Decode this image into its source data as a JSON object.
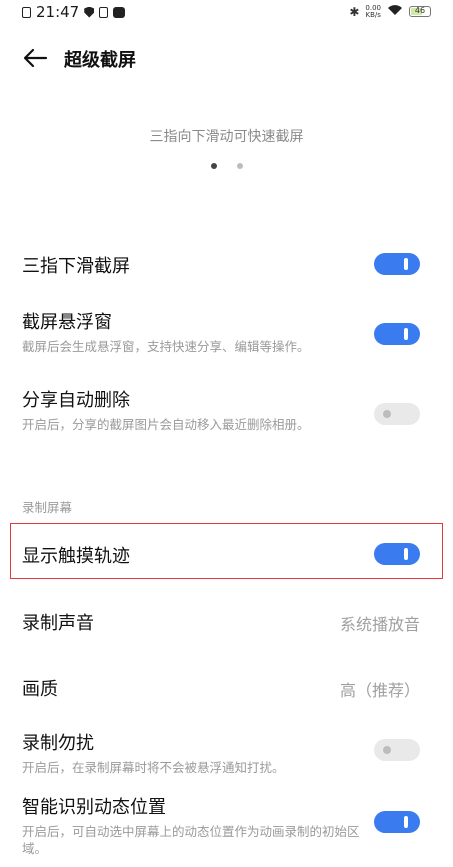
{
  "status_bar": {
    "time": "21:47",
    "net_speed_value": "0.00",
    "net_speed_unit": "KB/s",
    "battery": "46"
  },
  "header": {
    "title": "超级截屏"
  },
  "banner": {
    "hint": "三指向下滑动可快速截屏"
  },
  "settings": [
    {
      "label": "三指下滑截屏",
      "desc": "",
      "toggle": true
    },
    {
      "label": "截屏悬浮窗",
      "desc": "截屏后会生成悬浮窗，支持快速分享、编辑等操作。",
      "toggle": true
    },
    {
      "label": "分享自动删除",
      "desc": "开启后，分享的截屏图片会自动移入最近删除相册。",
      "toggle": false
    }
  ],
  "recording": {
    "section_title": "录制屏幕",
    "show_touch": {
      "label": "显示触摸轨迹",
      "toggle": true
    },
    "audio": {
      "label": "录制声音",
      "value": "系统播放音"
    },
    "quality": {
      "label": "画质",
      "value": "高（推荐）"
    },
    "dnd": {
      "label": "录制勿扰",
      "desc": "开启后，在录制屏幕时将不会被悬浮通知打扰。",
      "toggle": false
    },
    "smart_region": {
      "label": "智能识别动态位置",
      "desc": "开启后，可自动选中屏幕上的动态位置作为动画录制的初始区域。",
      "toggle": true
    }
  },
  "colors": {
    "accent": "#3a7bf0",
    "highlight_border": "#e5383b"
  }
}
